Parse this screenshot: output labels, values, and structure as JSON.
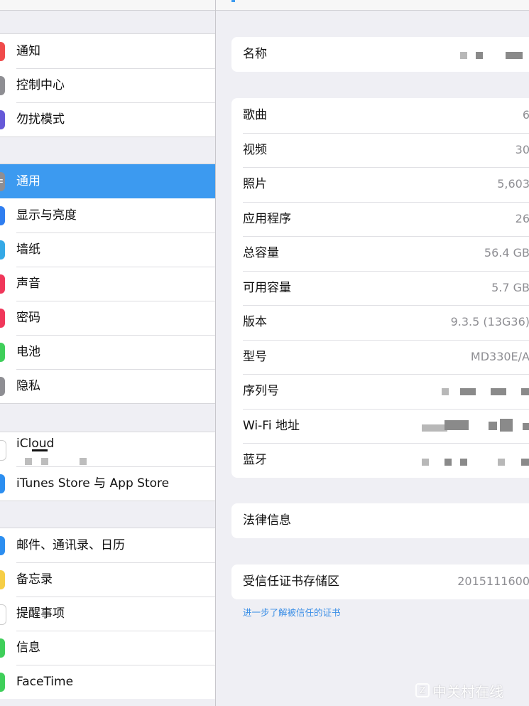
{
  "sidebar": {
    "groups": [
      {
        "items": [
          {
            "label": "通知",
            "icon": "notifications-icon",
            "color": "#f04b4b"
          },
          {
            "label": "控制中心",
            "icon": "control-center-icon",
            "color": "#8e8e93"
          },
          {
            "label": "勿扰模式",
            "icon": "do-not-disturb-icon",
            "color": "#6659d8"
          }
        ]
      },
      {
        "items": [
          {
            "label": "通用",
            "icon": "gear-icon",
            "color": "#8e8e93",
            "selected": true
          },
          {
            "label": "显示与亮度",
            "icon": "display-icon",
            "color": "#2f7ef0"
          },
          {
            "label": "墙纸",
            "icon": "wallpaper-icon",
            "color": "#35a9e6"
          },
          {
            "label": "声音",
            "icon": "sound-icon",
            "color": "#f0375a"
          },
          {
            "label": "密码",
            "icon": "passcode-icon",
            "color": "#f0375a"
          },
          {
            "label": "电池",
            "icon": "battery-icon",
            "color": "#3fcf5a"
          },
          {
            "label": "隐私",
            "icon": "privacy-hand-icon",
            "color": "#8e8e93"
          }
        ]
      },
      {
        "items": [
          {
            "label": "iCloud",
            "icon": "icloud-icon",
            "color": "#ffffff"
          },
          {
            "label": "iTunes Store 与 App Store",
            "icon": "app-store-icon",
            "color": "#2c8ef0"
          }
        ]
      },
      {
        "items": [
          {
            "label": "邮件、通讯录、日历",
            "icon": "mail-icon",
            "color": "#2c8ef0"
          },
          {
            "label": "备忘录",
            "icon": "notes-icon",
            "color": "#f6ce46"
          },
          {
            "label": "提醒事项",
            "icon": "reminders-icon",
            "color": "#ffffff"
          },
          {
            "label": "信息",
            "icon": "messages-icon",
            "color": "#3fcf5a"
          },
          {
            "label": "FaceTime",
            "icon": "facetime-icon",
            "color": "#3fcf5a"
          }
        ]
      }
    ]
  },
  "about": {
    "name": {
      "label": "名称"
    },
    "media": [
      {
        "label": "歌曲",
        "value": "6"
      },
      {
        "label": "视频",
        "value": "30"
      },
      {
        "label": "照片",
        "value": "5,603"
      },
      {
        "label": "应用程序",
        "value": "26"
      },
      {
        "label": "总容量",
        "value": "56.4 GB"
      },
      {
        "label": "可用容量",
        "value": "5.7 GB"
      },
      {
        "label": "版本",
        "value": "9.3.5 (13G36)"
      },
      {
        "label": "型号",
        "value": "MD330E/A"
      },
      {
        "label": "序列号",
        "value": ""
      },
      {
        "label": "Wi-Fi 地址",
        "value": ""
      },
      {
        "label": "蓝牙",
        "value": ""
      }
    ],
    "legal": {
      "label": "法律信息"
    },
    "trust": {
      "label": "受信任证书存储区",
      "value": "2015111600"
    },
    "trust_link": "进一步了解被信任的证书"
  },
  "watermark": {
    "text": "中关村在线"
  }
}
